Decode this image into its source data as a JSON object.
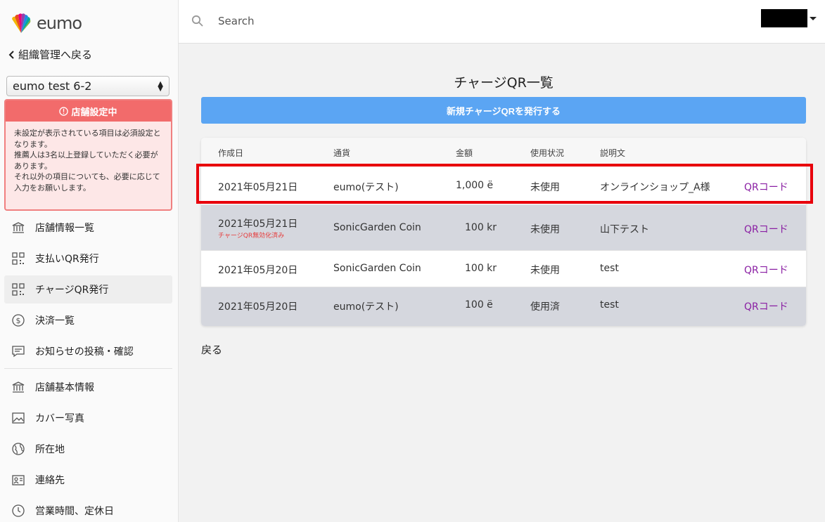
{
  "app": {
    "logo_text": "eumo"
  },
  "sidebar": {
    "back_label": "組織管理へ戻る",
    "store_select": "eumo test 6-2",
    "alert": {
      "title": "店舗設定中",
      "lines": [
        "未設定が表示されている項目は必須設定となります。",
        "推薦人は3名以上登録していただく必要があります。",
        "それ以外の項目についても、必要に応じて入力をお願いします。"
      ]
    },
    "nav_primary": [
      {
        "label": "店舗情報一覧",
        "icon": "bank-icon",
        "active": false
      },
      {
        "label": "支払いQR発行",
        "icon": "qr-icon",
        "active": false
      },
      {
        "label": "チャージQR発行",
        "icon": "qr-icon",
        "active": true
      },
      {
        "label": "決済一覧",
        "icon": "dollar-icon",
        "active": false
      },
      {
        "label": "お知らせの投稿・確認",
        "icon": "message-icon",
        "active": false
      }
    ],
    "nav_secondary": [
      {
        "label": "店舗基本情報",
        "icon": "bank-icon"
      },
      {
        "label": "カバー写真",
        "icon": "image-icon"
      },
      {
        "label": "所在地",
        "icon": "globe-icon"
      },
      {
        "label": "連絡先",
        "icon": "contact-card-icon"
      },
      {
        "label": "営業時間、定休日",
        "icon": "clock-icon"
      }
    ]
  },
  "topbar": {
    "search_placeholder": "Search"
  },
  "main": {
    "title": "チャージQR一覧",
    "issue_button": "新規チャージQRを発行する",
    "table": {
      "headers": [
        "作成日",
        "通貨",
        "金額",
        "使用状況",
        "説明文"
      ],
      "rows": [
        {
          "date": "2021年05月21日",
          "note": "",
          "currency": "eumo(テスト)",
          "amount": "1,000 ë",
          "status": "未使用",
          "description": "オンラインショップ_A様",
          "action": "QRコード",
          "gray": false
        },
        {
          "date": "2021年05月21日",
          "note": "チャージQR無効化済み",
          "currency": "SonicGarden Coin",
          "amount": "100 kr",
          "status": "未使用",
          "description": "山下テスト",
          "action": "QRコード",
          "gray": true
        },
        {
          "date": "2021年05月20日",
          "note": "",
          "currency": "SonicGarden Coin",
          "amount": "100 kr",
          "status": "未使用",
          "description": "test",
          "action": "QRコード",
          "gray": false
        },
        {
          "date": "2021年05月20日",
          "note": "",
          "currency": "eumo(テスト)",
          "amount": "100 ë",
          "status": "使用済",
          "description": "test",
          "action": "QRコード",
          "gray": true
        }
      ]
    },
    "back_label": "戻る"
  },
  "colors": {
    "primary_button": "#5ba5f3",
    "alert_header": "#f26b6b",
    "alert_bg": "#fde7e7",
    "link": "#8a1fa3",
    "highlight": "#e8000b",
    "disabled_row": "#d5d7de"
  }
}
